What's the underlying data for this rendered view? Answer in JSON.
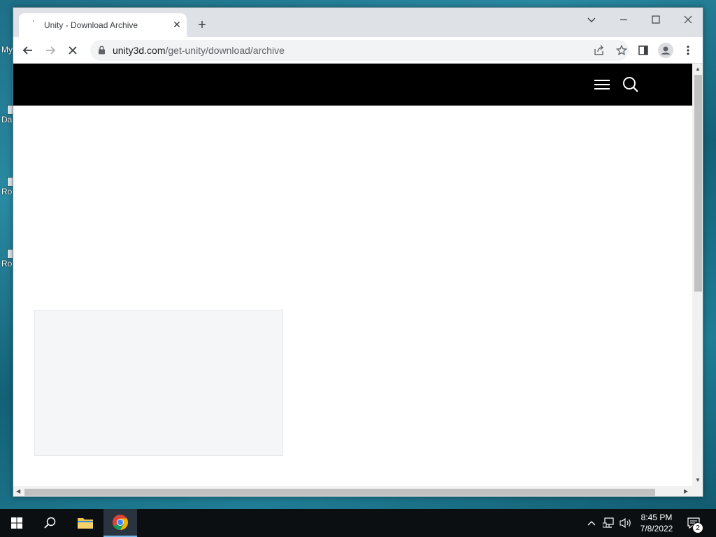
{
  "desktop": {
    "icons": [
      {
        "label": "My"
      },
      {
        "label": "Da"
      },
      {
        "label": "Ro"
      },
      {
        "label": "Ro"
      }
    ]
  },
  "browser": {
    "tab": {
      "title": "Unity - Download Archive"
    },
    "address": {
      "domain": "unity3d.com",
      "path": "/get-unity/download/archive"
    }
  },
  "site": {
    "header_color": "#000000"
  },
  "taskbar": {
    "time": "8:45 PM",
    "date": "7/8/2022",
    "notification_count": "2"
  }
}
